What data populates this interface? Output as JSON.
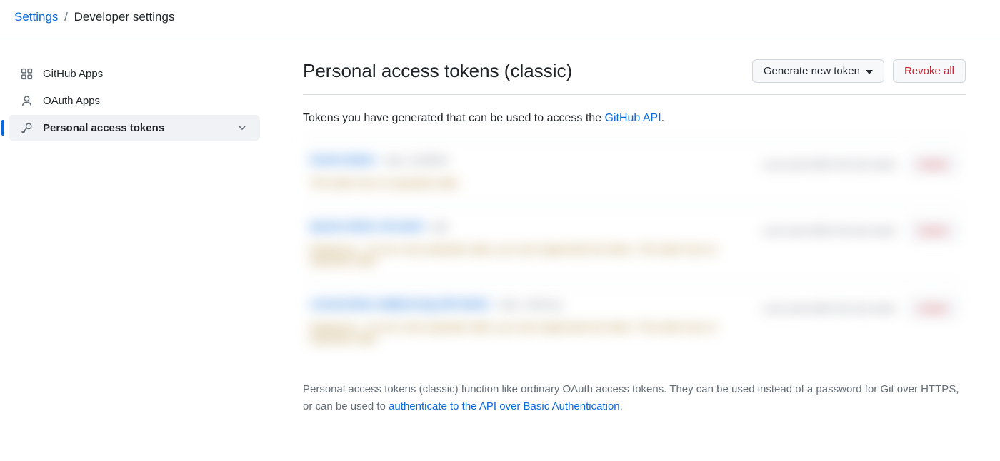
{
  "breadcrumb": {
    "root": "Settings",
    "separator": "/",
    "current": "Developer settings"
  },
  "sidebar": {
    "items": [
      {
        "id": "github-apps",
        "label": "GitHub Apps",
        "icon": "apps-icon",
        "active": false,
        "expandable": false
      },
      {
        "id": "oauth-apps",
        "label": "OAuth Apps",
        "icon": "person-icon",
        "active": false,
        "expandable": false
      },
      {
        "id": "personal-access-tokens",
        "label": "Personal access tokens",
        "icon": "key-icon",
        "active": true,
        "expandable": true
      }
    ]
  },
  "main": {
    "title": "Personal access tokens (classic)",
    "generate_button": "Generate new token",
    "revoke_button": "Revoke all",
    "intro_text": "Tokens you have generated that can be used to access the ",
    "intro_link": "GitHub API",
    "intro_suffix": ".",
    "footer_prefix": "Personal access tokens (classic) function like ordinary OAuth access tokens. They can be used instead of a password for Git over HTTPS, or can be used to ",
    "footer_link": "authenticate to the API over Basic Authentication",
    "footer_suffix": "."
  },
  "tokens": [
    {
      "name": "lorem-token",
      "scope": "repo, workflow",
      "last_used": "Last used within the last week",
      "delete": "Delete",
      "warn": "This token has no expiration date."
    },
    {
      "name": "ipsum-dolor-sit-amet",
      "scope": "gist",
      "last_used": "Last used within the last week",
      "delete": "Delete",
      "warn": "Expired on . To set a new expiration date, you must regenerate the token. This token has no expiration date."
    },
    {
      "name": "consectetur-adipiscing-elit-token",
      "scope": "repo, read:org",
      "last_used": "Last used within the last week",
      "delete": "Delete",
      "warn": "Expired on . To set a new expiration date, you must regenerate the token. This token has no expiration date."
    }
  ]
}
